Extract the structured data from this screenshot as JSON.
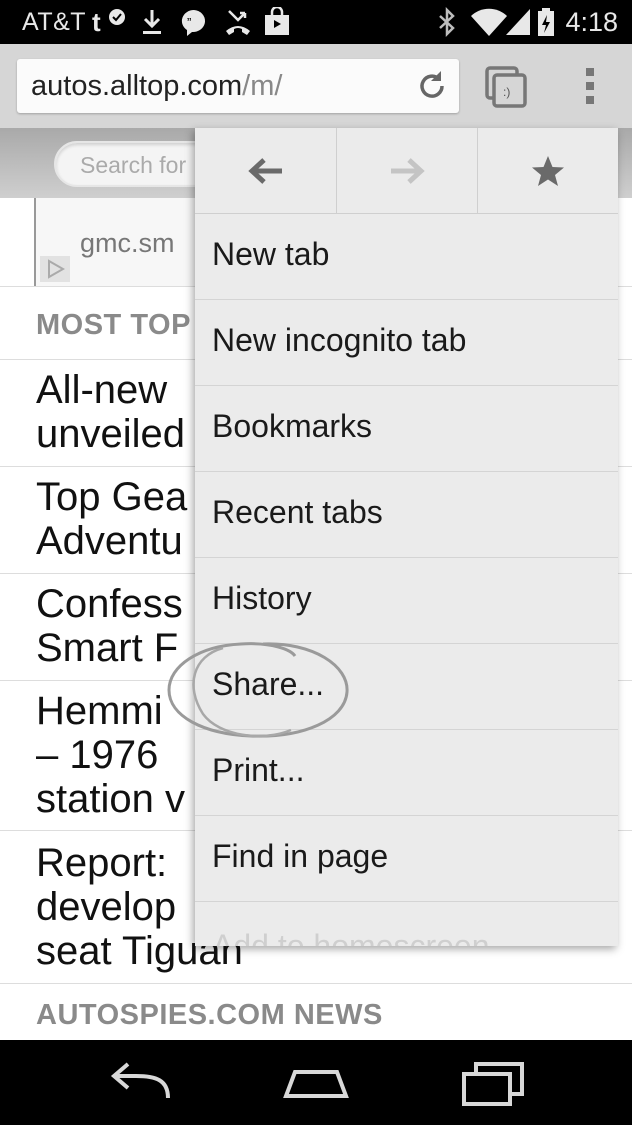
{
  "status_bar": {
    "carrier": "AT&T",
    "time": "4:18",
    "icons": [
      "t-mobile-icon",
      "download-icon",
      "hangouts-icon",
      "missed-call-icon",
      "shopping-bag-icon",
      "bluetooth-icon",
      "wifi-icon",
      "signal-icon",
      "battery-icon"
    ]
  },
  "toolbar": {
    "url_host": "autos.alltop.com",
    "url_path": "/m/",
    "icons": [
      "reload-icon",
      "tab-switcher-icon",
      "overflow-menu-icon"
    ]
  },
  "page": {
    "search_placeholder": "Search for",
    "ad_text": "gmc.sm",
    "section_most_topical": "MOST TOP",
    "headlines": [
      "All-new\nunveiled",
      "Top Gea\nAdventu",
      "Confess\nSmart F",
      "Hemmi\n– 1976\nstation v",
      "Report:\ndevelop\nseat Tiguan"
    ],
    "section_news": "AUTOSPIES.COM NEWS"
  },
  "menu": {
    "nav_icons": [
      "back-arrow-icon",
      "forward-arrow-icon",
      "star-bookmark-icon"
    ],
    "items": [
      "New tab",
      "New incognito tab",
      "Bookmarks",
      "Recent tabs",
      "History",
      "Share...",
      "Print...",
      "Find in page",
      "Add to homescreen"
    ]
  },
  "navbar": {
    "icons": [
      "back-icon",
      "home-icon",
      "recents-icon"
    ]
  },
  "colors": {
    "status_bar_bg": "#000000",
    "toolbar_bg": "#d6d6d6",
    "menu_bg": "#ebebeb",
    "section_head_text": "#8a8a8a"
  }
}
